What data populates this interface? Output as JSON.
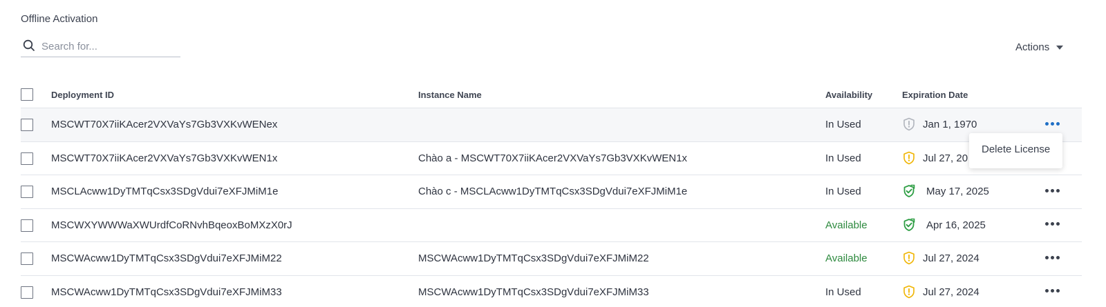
{
  "page": {
    "section_title": "Offline Activation"
  },
  "search": {
    "placeholder": "Search for...",
    "icon": "search-icon"
  },
  "actions": {
    "label": "Actions",
    "icon": "caret-down-icon"
  },
  "table": {
    "columns": {
      "deployment_id": "Deployment ID",
      "instance_name": "Instance Name",
      "availability": "Availability",
      "expiration_date": "Expiration Date"
    },
    "rows": [
      {
        "deployment_id": "MSCWT70X7iiKAcer2VXVaYs7Gb3VXKvWENex",
        "instance_name": "",
        "availability": "In Used",
        "expiration_icon": "shield-alert-gray-icon",
        "expiration_date": "Jan 1, 1970"
      },
      {
        "deployment_id": "MSCWT70X7iiKAcer2VXVaYs7Gb3VXKvWEN1x",
        "instance_name": "Chào a - MSCWT70X7iiKAcer2VXVaYs7Gb3VXKvWEN1x",
        "availability": "In Used",
        "expiration_icon": "shield-alert-amber-icon",
        "expiration_date": "Jul 27, 20"
      },
      {
        "deployment_id": "MSCLAcww1DyTMTqCsx3SDgVdui7eXFJMiM1e",
        "instance_name": "Chào c - MSCLAcww1DyTMTqCsx3SDgVdui7eXFJMiM1e",
        "availability": "In Used",
        "expiration_icon": "shield-check-green-icon",
        "expiration_date": "May 17, 2025"
      },
      {
        "deployment_id": "MSCWXYWWWaXWUrdfCoRNvhBqeoxBoMXzX0rJ",
        "instance_name": "",
        "availability": "Available",
        "expiration_icon": "shield-check-green-icon",
        "expiration_date": "Apr 16, 2025"
      },
      {
        "deployment_id": "MSCWAcww1DyTMTqCsx3SDgVdui7eXFJMiM22",
        "instance_name": "MSCWAcww1DyTMTqCsx3SDgVdui7eXFJMiM22",
        "availability": "Available",
        "expiration_icon": "shield-alert-amber-icon",
        "expiration_date": "Jul 27, 2024"
      },
      {
        "deployment_id": "MSCWAcww1DyTMTqCsx3SDgVdui7eXFJMiM33",
        "instance_name": "MSCWAcww1DyTMTqCsx3SDgVdui7eXFJMiM33",
        "availability": "In Used",
        "expiration_icon": "shield-alert-amber-icon",
        "expiration_date": "Jul 27, 2024"
      }
    ]
  },
  "row_menu": {
    "delete_label": "Delete License"
  },
  "colors": {
    "available": "#2e8a3f",
    "warning": "#f0b400",
    "valid": "#2e9e44",
    "expired": "#b0b4bc",
    "active_menu_dots": "#1f6fc5"
  }
}
